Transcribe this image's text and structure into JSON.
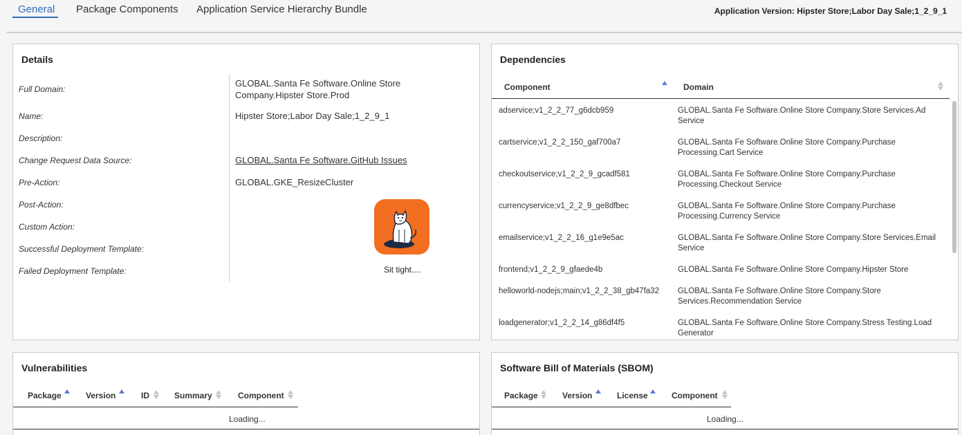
{
  "tabs": [
    {
      "label": "General"
    },
    {
      "label": "Package Components"
    },
    {
      "label": "Application Service Hierarchy Bundle"
    }
  ],
  "app_version": "Application Version: Hipster Store;Labor Day Sale;1_2_9_1",
  "details": {
    "title": "Details",
    "full_domain_label": "Full Domain:",
    "full_domain_value_line1": "GLOBAL.Santa Fe Software.Online Store",
    "full_domain_value_line2": "Company.Hipster Store.Prod",
    "name_label": "Name:",
    "name_value": "Hipster Store;Labor Day Sale;1_2_9_1",
    "description_label": "Description:",
    "change_request_label": "Change Request Data Source:",
    "change_request_value": "GLOBAL.Santa Fe Software.GitHub Issues",
    "pre_action_label": "Pre-Action:",
    "pre_action_value": "GLOBAL.GKE_ResizeCluster",
    "post_action_label": "Post-Action:",
    "custom_action_label": "Custom Action:",
    "successful_template_label": "Successful Deployment Template:",
    "failed_template_label": "Failed Deployment Template:",
    "loading_text": "Sit tight...."
  },
  "dependencies": {
    "title": "Dependencies",
    "col_component": "Component",
    "col_domain": "Domain",
    "rows": [
      {
        "c1": "adservice;v1_2_2_77_g6dcb959",
        "c2": "GLOBAL.Santa Fe Software.Online Store Company.Store Services.Ad Service"
      },
      {
        "c1": "cartservice;v1_2_2_150_gaf700a7",
        "c2": "GLOBAL.Santa Fe Software.Online Store Company.Purchase Processing.Cart Service"
      },
      {
        "c1": "checkoutservice;v1_2_2_9_gcadf581",
        "c2": "GLOBAL.Santa Fe Software.Online Store Company.Purchase Processing.Checkout Service"
      },
      {
        "c1": "currencyservice;v1_2_2_9_ge8dfbec",
        "c2": "GLOBAL.Santa Fe Software.Online Store Company.Purchase Processing.Currency Service"
      },
      {
        "c1": "emailservice;v1_2_2_16_g1e9e5ac",
        "c2": "GLOBAL.Santa Fe Software.Online Store Company.Store Services.Email Service"
      },
      {
        "c1": "frontend;v1_2_2_9_gfaede4b",
        "c2": "GLOBAL.Santa Fe Software.Online Store Company.Hipster Store"
      },
      {
        "c1": "helloworld-nodejs;main;v1_2_2_38_gb47fa32",
        "c2": "GLOBAL.Santa Fe Software.Online Store Company.Store Services.Recommendation Service"
      },
      {
        "c1": "loadgenerator;v1_2_2_14_g86df4f5",
        "c2": "GLOBAL.Santa Fe Software.Online Store Company.Stress Testing.Load Generator"
      }
    ]
  },
  "vulnerabilities": {
    "title": "Vulnerabilities",
    "col_package": "Package",
    "col_version": "Version",
    "col_id": "ID",
    "col_summary": "Summary",
    "col_component": "Component",
    "loading": "Loading..."
  },
  "sbom": {
    "title": "Software Bill of Materials (SBOM)",
    "col_package": "Package",
    "col_version": "Version",
    "col_license": "License",
    "col_component": "Component",
    "loading": "Loading..."
  },
  "colors": {
    "accent": "#2e6fb7",
    "sort_active": "#5b7bd5",
    "cat_background": "#f26e21"
  }
}
